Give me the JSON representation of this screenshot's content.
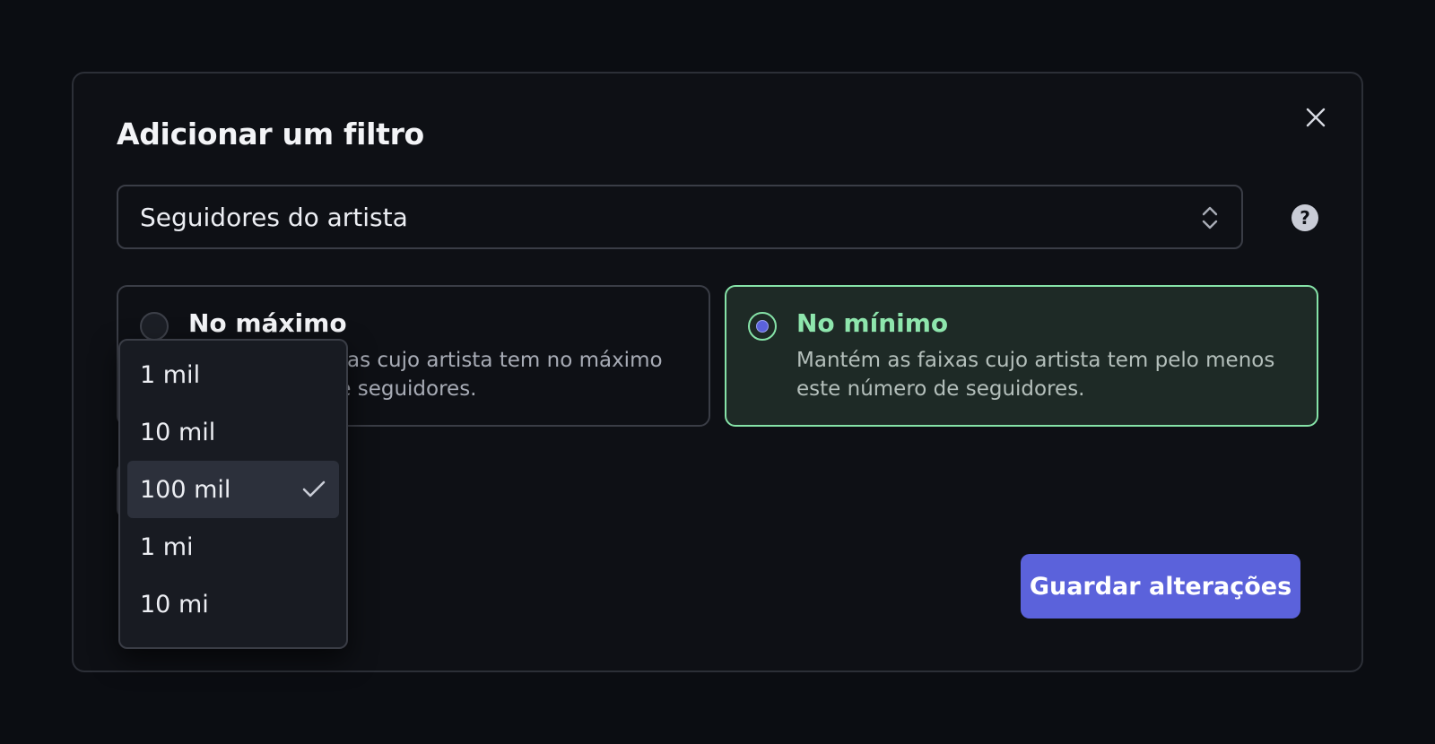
{
  "dialog": {
    "title": "Adicionar um filtro",
    "close_icon": "close-icon",
    "help_label": "?"
  },
  "field_select": {
    "value": "Seguidores do artista",
    "icon": "chevron-up-down-icon"
  },
  "options": {
    "at_most": {
      "title": "No máximo",
      "description": "Mantém as faixas cujo artista tem no máximo este número de seguidores.",
      "selected": false
    },
    "at_least": {
      "title": "No mínimo",
      "description": "Mantém as faixas cujo artista tem pelo menos este número de seguidores.",
      "selected": true
    }
  },
  "follower_dropdown": {
    "items": [
      {
        "label": "1 mil",
        "selected": false
      },
      {
        "label": "10 mil",
        "selected": false
      },
      {
        "label": "100 mil",
        "selected": true
      },
      {
        "label": "1 mi",
        "selected": false
      },
      {
        "label": "10 mi",
        "selected": false
      }
    ]
  },
  "footer": {
    "save_label": "Guardar alterações"
  },
  "colors": {
    "accent": "#5b62db",
    "selected_border": "#86e3a8",
    "selected_bg": "#1e2a26",
    "background": "#0b0d12"
  }
}
